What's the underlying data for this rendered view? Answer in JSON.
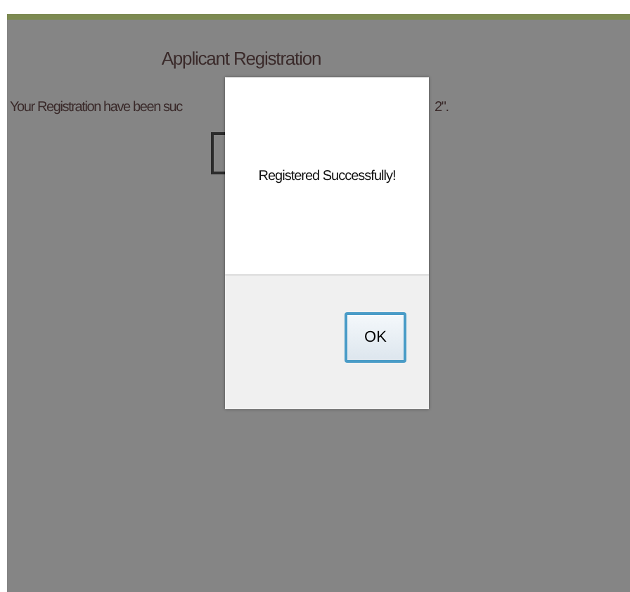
{
  "page": {
    "title": "Applicant Registration",
    "message_left": "Your Registration have been suc",
    "message_right": "2\"."
  },
  "dialog": {
    "message": "Registered Successfully!",
    "buttons": [
      "OK"
    ]
  }
}
